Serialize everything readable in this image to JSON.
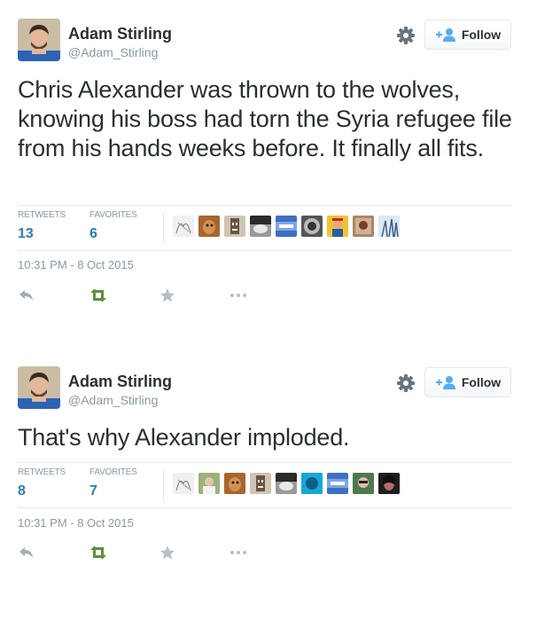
{
  "tweets": [
    {
      "author": {
        "name": "Adam Stirling",
        "handle": "@Adam_Stirling"
      },
      "follow_label": "Follow",
      "text": "Chris Alexander was thrown to the wolves, knowing his boss had torn the Syria refugee file from his hands weeks before. It finally all fits.",
      "retweets_label": "RETWEETS",
      "retweets": "13",
      "favorites_label": "FAVORITES",
      "favorites": "6",
      "favoriter_avatars": 9,
      "timestamp": "10:31 PM - 8 Oct 2015"
    },
    {
      "author": {
        "name": "Adam Stirling",
        "handle": "@Adam_Stirling"
      },
      "follow_label": "Follow",
      "text": "That's why Alexander imploded.",
      "retweets_label": "RETWEETS",
      "retweets": "8",
      "favorites_label": "FAVORITES",
      "favorites": "7",
      "favoriter_avatars": 9,
      "timestamp": "10:31 PM - 8 Oct 2015"
    }
  ],
  "icons": {
    "settings": "gear-icon",
    "follow": "add-person-icon",
    "reply": "reply-icon",
    "retweet": "retweet-icon",
    "favorite": "star-icon",
    "more": "more-icon"
  },
  "colors": {
    "link_blue": "#2b7bb9",
    "follow_blue": "#55acee",
    "retweet_green": "#5c913b",
    "muted": "#8899a6",
    "text": "#292f33"
  }
}
